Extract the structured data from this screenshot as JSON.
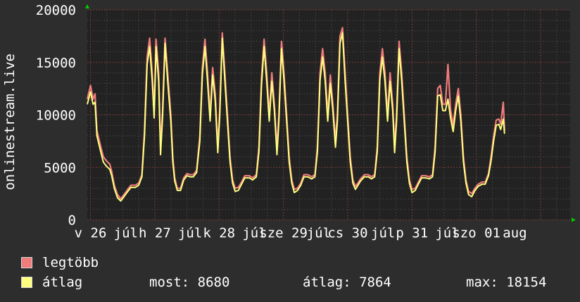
{
  "chart_data": {
    "type": "line",
    "ylabel": "onlinestream.live",
    "ylim": [
      0,
      20000
    ],
    "yticks": [
      0,
      5000,
      10000,
      15000,
      20000
    ],
    "xticks": [
      {
        "day": 0.0,
        "label": "v 26"
      },
      {
        "day": 0.55,
        "label": "júl"
      },
      {
        "day": 1.0,
        "label": "h 27"
      },
      {
        "day": 1.55,
        "label": "júl"
      },
      {
        "day": 2.0,
        "label": "k 28"
      },
      {
        "day": 2.55,
        "label": "júl"
      },
      {
        "day": 3.0,
        "label": "sze 29"
      },
      {
        "day": 3.55,
        "label": "júl"
      },
      {
        "day": 4.0,
        "label": "cs 30"
      },
      {
        "day": 4.55,
        "label": "júl"
      },
      {
        "day": 5.0,
        "label": "p 31"
      },
      {
        "day": 5.55,
        "label": "júl"
      },
      {
        "day": 6.0,
        "label": "szo 01"
      },
      {
        "day": 6.6,
        "label": "aug"
      }
    ],
    "xlim_days": [
      -0.05,
      7.46
    ],
    "grid": true,
    "series": [
      {
        "name": "legtöbb",
        "color": "#f07c7c",
        "points": [
          [
            -0.05,
            11500
          ],
          [
            0.0,
            12800
          ],
          [
            0.04,
            11500
          ],
          [
            0.07,
            12000
          ],
          [
            0.1,
            8500
          ],
          [
            0.15,
            7200
          ],
          [
            0.2,
            6000
          ],
          [
            0.25,
            5600
          ],
          [
            0.3,
            5300
          ],
          [
            0.33,
            4600
          ],
          [
            0.37,
            3300
          ],
          [
            0.42,
            2400
          ],
          [
            0.47,
            2000
          ],
          [
            0.52,
            2400
          ],
          [
            0.58,
            2900
          ],
          [
            0.63,
            3300
          ],
          [
            0.7,
            3300
          ],
          [
            0.75,
            3500
          ],
          [
            0.8,
            4300
          ],
          [
            0.84,
            8500
          ],
          [
            0.88,
            15500
          ],
          [
            0.92,
            17300
          ],
          [
            0.96,
            14000
          ],
          [
            0.99,
            10300
          ],
          [
            1.02,
            17200
          ],
          [
            1.06,
            14000
          ],
          [
            1.09,
            7000
          ],
          [
            1.12,
            10300
          ],
          [
            1.16,
            17300
          ],
          [
            1.2,
            14000
          ],
          [
            1.25,
            10000
          ],
          [
            1.28,
            6000
          ],
          [
            1.31,
            4000
          ],
          [
            1.35,
            3000
          ],
          [
            1.4,
            3000
          ],
          [
            1.45,
            4000
          ],
          [
            1.5,
            4400
          ],
          [
            1.55,
            4300
          ],
          [
            1.6,
            4300
          ],
          [
            1.65,
            4700
          ],
          [
            1.7,
            8000
          ],
          [
            1.74,
            14500
          ],
          [
            1.78,
            17200
          ],
          [
            1.82,
            14000
          ],
          [
            1.86,
            10000
          ],
          [
            1.9,
            14500
          ],
          [
            1.94,
            12000
          ],
          [
            1.98,
            7000
          ],
          [
            2.01,
            10500
          ],
          [
            2.05,
            17800
          ],
          [
            2.09,
            14000
          ],
          [
            2.13,
            10000
          ],
          [
            2.17,
            6000
          ],
          [
            2.21,
            3800
          ],
          [
            2.25,
            3000
          ],
          [
            2.3,
            3100
          ],
          [
            2.35,
            3600
          ],
          [
            2.4,
            4200
          ],
          [
            2.47,
            4200
          ],
          [
            2.52,
            4000
          ],
          [
            2.58,
            4300
          ],
          [
            2.62,
            7000
          ],
          [
            2.66,
            13500
          ],
          [
            2.7,
            17200
          ],
          [
            2.74,
            14000
          ],
          [
            2.78,
            10000
          ],
          [
            2.82,
            14000
          ],
          [
            2.86,
            11000
          ],
          [
            2.9,
            6800
          ],
          [
            2.93,
            10000
          ],
          [
            2.97,
            17000
          ],
          [
            3.01,
            14000
          ],
          [
            3.05,
            10000
          ],
          [
            3.09,
            6000
          ],
          [
            3.13,
            3800
          ],
          [
            3.17,
            2900
          ],
          [
            3.22,
            3000
          ],
          [
            3.27,
            3500
          ],
          [
            3.32,
            4300
          ],
          [
            3.38,
            4300
          ],
          [
            3.44,
            4100
          ],
          [
            3.49,
            4300
          ],
          [
            3.53,
            7000
          ],
          [
            3.57,
            14000
          ],
          [
            3.61,
            16300
          ],
          [
            3.65,
            14000
          ],
          [
            3.69,
            10000
          ],
          [
            3.73,
            13800
          ],
          [
            3.77,
            11000
          ],
          [
            3.81,
            7500
          ],
          [
            3.84,
            10000
          ],
          [
            3.88,
            17500
          ],
          [
            3.92,
            18300
          ],
          [
            3.96,
            14000
          ],
          [
            4.0,
            10000
          ],
          [
            4.04,
            6000
          ],
          [
            4.08,
            3800
          ],
          [
            4.12,
            3200
          ],
          [
            4.16,
            3500
          ],
          [
            4.2,
            3900
          ],
          [
            4.26,
            4300
          ],
          [
            4.32,
            4300
          ],
          [
            4.37,
            4100
          ],
          [
            4.42,
            4300
          ],
          [
            4.46,
            7000
          ],
          [
            4.5,
            14000
          ],
          [
            4.54,
            16300
          ],
          [
            4.58,
            14000
          ],
          [
            4.62,
            10000
          ],
          [
            4.66,
            14000
          ],
          [
            4.7,
            11000
          ],
          [
            4.73,
            7000
          ],
          [
            4.76,
            10000
          ],
          [
            4.8,
            17000
          ],
          [
            4.84,
            14000
          ],
          [
            4.88,
            10000
          ],
          [
            4.92,
            6000
          ],
          [
            4.96,
            3800
          ],
          [
            5.0,
            2900
          ],
          [
            5.05,
            3000
          ],
          [
            5.1,
            3600
          ],
          [
            5.15,
            4200
          ],
          [
            5.21,
            4200
          ],
          [
            5.27,
            4100
          ],
          [
            5.32,
            4300
          ],
          [
            5.36,
            7000
          ],
          [
            5.4,
            12500
          ],
          [
            5.44,
            12800
          ],
          [
            5.48,
            11000
          ],
          [
            5.52,
            11000
          ],
          [
            5.56,
            14800
          ],
          [
            5.6,
            10500
          ],
          [
            5.64,
            9000
          ],
          [
            5.68,
            11000
          ],
          [
            5.72,
            12500
          ],
          [
            5.76,
            10000
          ],
          [
            5.8,
            6000
          ],
          [
            5.84,
            3800
          ],
          [
            5.88,
            2700
          ],
          [
            5.93,
            2500
          ],
          [
            5.98,
            3000
          ],
          [
            6.03,
            3400
          ],
          [
            6.09,
            3600
          ],
          [
            6.14,
            3600
          ],
          [
            6.19,
            4400
          ],
          [
            6.23,
            6000
          ],
          [
            6.27,
            8000
          ],
          [
            6.31,
            9500
          ],
          [
            6.35,
            9600
          ],
          [
            6.38,
            9100
          ],
          [
            6.42,
            11200
          ],
          [
            6.44,
            8500
          ]
        ]
      },
      {
        "name": "átlag",
        "color": "#ffff80",
        "points": [
          [
            -0.05,
            11000
          ],
          [
            0.0,
            12200
          ],
          [
            0.04,
            11000
          ],
          [
            0.07,
            11200
          ],
          [
            0.1,
            8000
          ],
          [
            0.15,
            6700
          ],
          [
            0.2,
            5500
          ],
          [
            0.25,
            5100
          ],
          [
            0.3,
            4800
          ],
          [
            0.33,
            4200
          ],
          [
            0.37,
            3000
          ],
          [
            0.42,
            2100
          ],
          [
            0.47,
            1800
          ],
          [
            0.52,
            2200
          ],
          [
            0.58,
            2700
          ],
          [
            0.63,
            3100
          ],
          [
            0.7,
            3100
          ],
          [
            0.75,
            3300
          ],
          [
            0.8,
            4100
          ],
          [
            0.84,
            8000
          ],
          [
            0.88,
            14800
          ],
          [
            0.92,
            16500
          ],
          [
            0.96,
            13200
          ],
          [
            0.99,
            9700
          ],
          [
            1.02,
            16500
          ],
          [
            1.06,
            13200
          ],
          [
            1.09,
            6200
          ],
          [
            1.12,
            9700
          ],
          [
            1.16,
            16800
          ],
          [
            1.2,
            13200
          ],
          [
            1.25,
            9400
          ],
          [
            1.28,
            5500
          ],
          [
            1.31,
            3700
          ],
          [
            1.35,
            2800
          ],
          [
            1.4,
            2800
          ],
          [
            1.45,
            3800
          ],
          [
            1.5,
            4200
          ],
          [
            1.55,
            4100
          ],
          [
            1.6,
            4100
          ],
          [
            1.65,
            4500
          ],
          [
            1.7,
            7500
          ],
          [
            1.74,
            13800
          ],
          [
            1.78,
            16500
          ],
          [
            1.82,
            13200
          ],
          [
            1.86,
            9400
          ],
          [
            1.9,
            13800
          ],
          [
            1.94,
            11300
          ],
          [
            1.98,
            6400
          ],
          [
            2.01,
            9900
          ],
          [
            2.05,
            17300
          ],
          [
            2.09,
            13200
          ],
          [
            2.13,
            9400
          ],
          [
            2.17,
            5500
          ],
          [
            2.21,
            3500
          ],
          [
            2.25,
            2700
          ],
          [
            2.3,
            2800
          ],
          [
            2.35,
            3400
          ],
          [
            2.4,
            4000
          ],
          [
            2.47,
            4000
          ],
          [
            2.52,
            3800
          ],
          [
            2.58,
            4100
          ],
          [
            2.62,
            6500
          ],
          [
            2.66,
            12800
          ],
          [
            2.7,
            16500
          ],
          [
            2.74,
            13200
          ],
          [
            2.78,
            9400
          ],
          [
            2.82,
            13200
          ],
          [
            2.86,
            10400
          ],
          [
            2.9,
            6200
          ],
          [
            2.93,
            9400
          ],
          [
            2.97,
            16300
          ],
          [
            3.01,
            13200
          ],
          [
            3.05,
            9400
          ],
          [
            3.09,
            5500
          ],
          [
            3.13,
            3500
          ],
          [
            3.17,
            2600
          ],
          [
            3.22,
            2800
          ],
          [
            3.27,
            3300
          ],
          [
            3.32,
            4100
          ],
          [
            3.38,
            4100
          ],
          [
            3.44,
            3900
          ],
          [
            3.49,
            4100
          ],
          [
            3.53,
            6500
          ],
          [
            3.57,
            13300
          ],
          [
            3.61,
            15500
          ],
          [
            3.65,
            13200
          ],
          [
            3.69,
            9400
          ],
          [
            3.73,
            13000
          ],
          [
            3.77,
            10400
          ],
          [
            3.81,
            6900
          ],
          [
            3.84,
            9400
          ],
          [
            3.88,
            16800
          ],
          [
            3.92,
            17800
          ],
          [
            3.96,
            13200
          ],
          [
            4.0,
            9400
          ],
          [
            4.04,
            5500
          ],
          [
            4.08,
            3500
          ],
          [
            4.12,
            2900
          ],
          [
            4.16,
            3300
          ],
          [
            4.2,
            3700
          ],
          [
            4.26,
            4100
          ],
          [
            4.32,
            4100
          ],
          [
            4.37,
            3900
          ],
          [
            4.42,
            4100
          ],
          [
            4.46,
            6500
          ],
          [
            4.5,
            13300
          ],
          [
            4.54,
            15500
          ],
          [
            4.58,
            13200
          ],
          [
            4.62,
            9400
          ],
          [
            4.66,
            13200
          ],
          [
            4.7,
            10400
          ],
          [
            4.73,
            6400
          ],
          [
            4.76,
            9400
          ],
          [
            4.8,
            16300
          ],
          [
            4.84,
            13200
          ],
          [
            4.88,
            9400
          ],
          [
            4.92,
            5500
          ],
          [
            4.96,
            3500
          ],
          [
            5.0,
            2600
          ],
          [
            5.05,
            2800
          ],
          [
            5.1,
            3400
          ],
          [
            5.15,
            4000
          ],
          [
            5.21,
            4000
          ],
          [
            5.27,
            3900
          ],
          [
            5.32,
            4100
          ],
          [
            5.36,
            6500
          ],
          [
            5.4,
            11800
          ],
          [
            5.44,
            11900
          ],
          [
            5.48,
            10400
          ],
          [
            5.52,
            10400
          ],
          [
            5.56,
            11500
          ],
          [
            5.6,
            9700
          ],
          [
            5.64,
            8400
          ],
          [
            5.68,
            10400
          ],
          [
            5.72,
            11800
          ],
          [
            5.76,
            9400
          ],
          [
            5.8,
            5500
          ],
          [
            5.84,
            3500
          ],
          [
            5.88,
            2400
          ],
          [
            5.93,
            2200
          ],
          [
            5.98,
            2800
          ],
          [
            6.03,
            3200
          ],
          [
            6.09,
            3400
          ],
          [
            6.14,
            3400
          ],
          [
            6.19,
            4200
          ],
          [
            6.23,
            5600
          ],
          [
            6.27,
            7500
          ],
          [
            6.31,
            9000
          ],
          [
            6.35,
            9100
          ],
          [
            6.38,
            8600
          ],
          [
            6.42,
            9600
          ],
          [
            6.44,
            8200
          ]
        ]
      }
    ]
  },
  "legend": {
    "max_label": "legtöbb",
    "avg_label": "átlag"
  },
  "stats": {
    "current": "most: 8680",
    "average": "átlag: 7864",
    "maximum": "max: 18154"
  },
  "colors": {
    "background": "#2d2d2d",
    "canvas": "#222222",
    "grid": "#555555",
    "axis_arrow": "#00cc00"
  }
}
